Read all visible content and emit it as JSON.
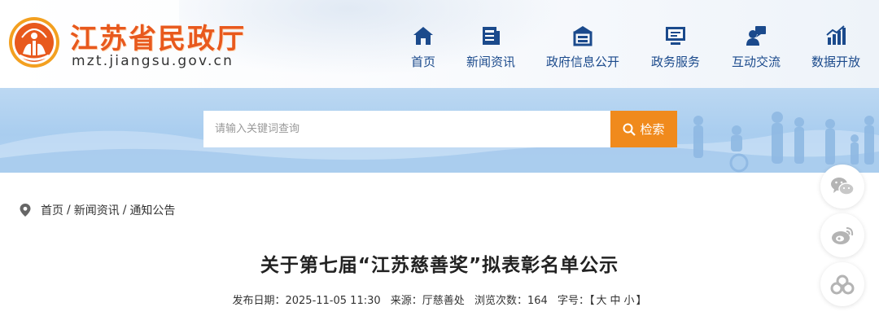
{
  "site": {
    "name": "江苏省民政厅",
    "domain": "mzt.jiangsu.gov.cn"
  },
  "nav": [
    {
      "label": "首页",
      "icon": "home-icon"
    },
    {
      "label": "新闻资讯",
      "icon": "news-icon"
    },
    {
      "label": "政府信息公开",
      "icon": "building-icon"
    },
    {
      "label": "政务服务",
      "icon": "monitor-icon"
    },
    {
      "label": "互动交流",
      "icon": "chat-user-icon"
    },
    {
      "label": "数据开放",
      "icon": "chart-icon"
    }
  ],
  "search": {
    "placeholder": "请输入关键词查询",
    "button_label": "检索"
  },
  "breadcrumb": [
    "首页",
    "新闻资讯",
    "通知公告"
  ],
  "article": {
    "title": "关于第七届“江苏慈善奖”拟表彰名单公示",
    "meta": {
      "publish_label": "发布日期：",
      "publish_date": "2025-11-05 11:30",
      "source_label": "来源：",
      "source": "厅慈善处",
      "views_label": "浏览次数：",
      "views": "164",
      "fontsize_label": "字号：",
      "fontsize_open": "【",
      "fontsize_large": "大",
      "fontsize_medium": "中",
      "fontsize_small": "小",
      "fontsize_close": "】"
    }
  },
  "share": [
    "wechat-icon",
    "weibo-icon",
    "more-share-icon"
  ],
  "colors": {
    "brand_orange": "#e8591d",
    "nav_blue": "#1b4a8c",
    "search_button": "#f08a1c",
    "banner_blue": "#a9cdef"
  }
}
